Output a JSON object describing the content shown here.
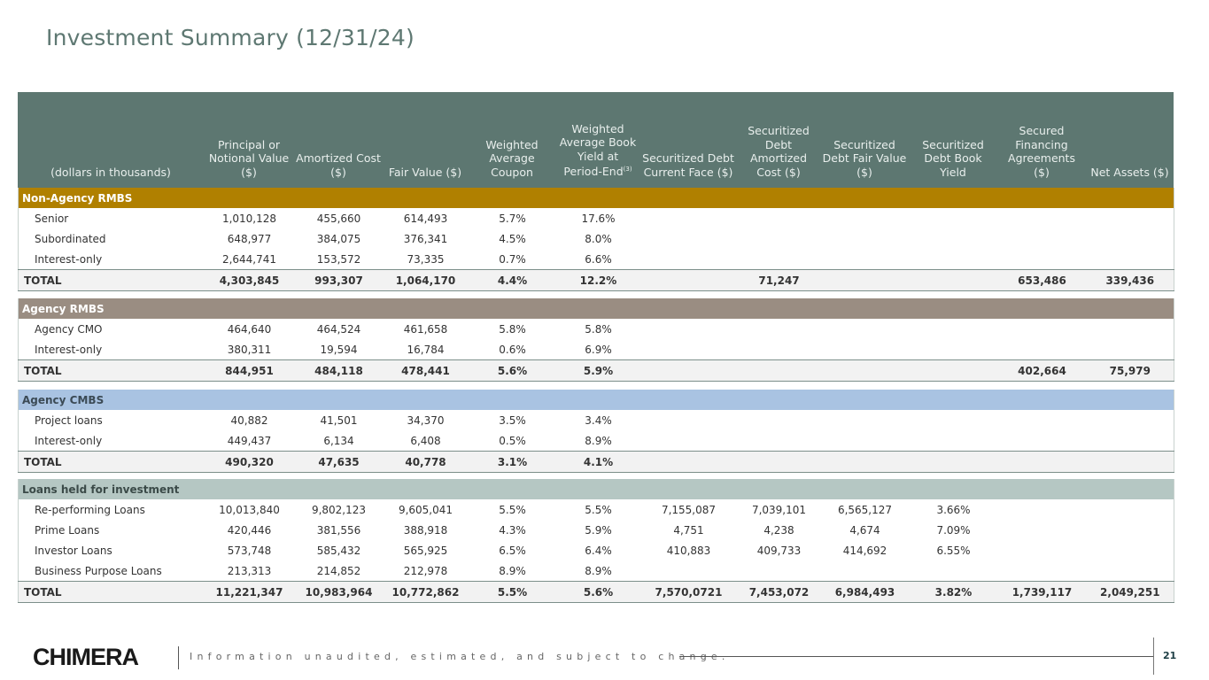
{
  "title": "Investment Summary (12/31/24)",
  "columns": [
    "(dollars in thousands)",
    "Principal or Notional Value ($)",
    "Amortized Cost ($)",
    "Fair Value ($)",
    "Weighted Average Coupon",
    "Weighted Average Book Yield at Period-End",
    "Securitized Debt Current Face ($)",
    "Securitized Debt Amortized Cost ($)",
    "Securitized Debt Fair Value ($)",
    "Securitized Debt Book Yield",
    "Secured Financing Agreements ($)",
    "Net Assets ($)"
  ],
  "yield_footnote": "(3)",
  "sections": [
    {
      "name": "Non-Agency RMBS",
      "color": "#b08000",
      "text_color": "#ffffff",
      "rows": [
        [
          "Senior",
          "1,010,128",
          "455,660",
          "614,493",
          "5.7%",
          "17.6%",
          "",
          "",
          "",
          "",
          "",
          ""
        ],
        [
          "Subordinated",
          "648,977",
          "384,075",
          "376,341",
          "4.5%",
          "8.0%",
          "",
          "",
          "",
          "",
          "",
          ""
        ],
        [
          "Interest-only",
          "2,644,741",
          "153,572",
          "73,335",
          "0.7%",
          "6.6%",
          "",
          "",
          "",
          "",
          "",
          ""
        ]
      ],
      "total": [
        "TOTAL",
        "4,303,845",
        "993,307",
        "1,064,170",
        "4.4%",
        "12.2%",
        "",
        "71,247",
        "",
        "",
        "653,486",
        "339,436"
      ]
    },
    {
      "name": "Agency RMBS",
      "color": "#9a8d82",
      "text_color": "#ffffff",
      "rows": [
        [
          "Agency CMO",
          "464,640",
          "464,524",
          "461,658",
          "5.8%",
          "5.8%",
          "",
          "",
          "",
          "",
          "",
          ""
        ],
        [
          "Interest-only",
          "380,311",
          "19,594",
          "16,784",
          "0.6%",
          "6.9%",
          "",
          "",
          "",
          "",
          "",
          ""
        ]
      ],
      "total": [
        "TOTAL",
        "844,951",
        "484,118",
        "478,441",
        "5.6%",
        "5.9%",
        "",
        "",
        "",
        "",
        "402,664",
        "75,979"
      ]
    },
    {
      "name": "Agency CMBS",
      "color": "#a9c3e2",
      "text_color": "#3b4a55",
      "rows": [
        [
          "Project loans",
          "40,882",
          "41,501",
          "34,370",
          "3.5%",
          "3.4%",
          "",
          "",
          "",
          "",
          "",
          ""
        ],
        [
          "Interest-only",
          "449,437",
          "6,134",
          "6,408",
          "0.5%",
          "8.9%",
          "",
          "",
          "",
          "",
          "",
          ""
        ]
      ],
      "total": [
        "TOTAL",
        "490,320",
        "47,635",
        "40,778",
        "3.1%",
        "4.1%",
        "",
        "",
        "",
        "",
        "",
        ""
      ]
    },
    {
      "name": "Loans held for investment",
      "color": "#b5c7c3",
      "text_color": "#3b4a48",
      "rows": [
        [
          "Re-performing Loans",
          "10,013,840",
          "9,802,123",
          "9,605,041",
          "5.5%",
          "5.5%",
          "7,155,087",
          "7,039,101",
          "6,565,127",
          "3.66%",
          "",
          ""
        ],
        [
          "Prime Loans",
          "420,446",
          "381,556",
          "388,918",
          "4.3%",
          "5.9%",
          "4,751",
          "4,238",
          "4,674",
          "7.09%",
          "",
          ""
        ],
        [
          "Investor Loans",
          "573,748",
          "585,432",
          "565,925",
          "6.5%",
          "6.4%",
          "410,883",
          "409,733",
          "414,692",
          "6.55%",
          "",
          ""
        ],
        [
          "Business Purpose Loans",
          "213,313",
          "214,852",
          "212,978",
          "8.9%",
          "8.9%",
          "",
          "",
          "",
          "",
          "",
          ""
        ]
      ],
      "total": [
        "TOTAL",
        "11,221,347",
        "10,983,964",
        "10,772,862",
        "5.5%",
        "5.6%",
        "7,570,0721",
        "7,453,072",
        "6,984,493",
        "3.82%",
        "1,739,117",
        "2,049,251"
      ]
    }
  ],
  "footer": {
    "logo": "CHIMERA",
    "disclaimer": "Information unaudited, estimated, and subject to change.",
    "page_number": "21"
  }
}
